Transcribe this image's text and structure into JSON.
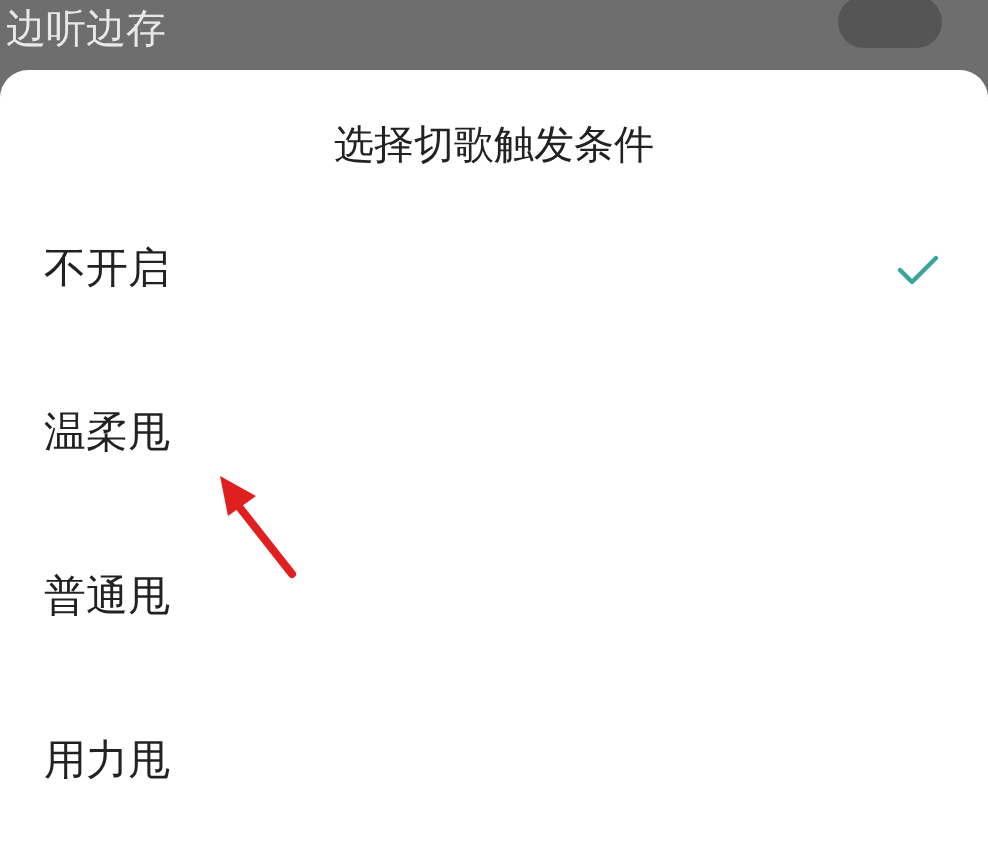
{
  "background_setting": {
    "label": "边听边存",
    "on": false
  },
  "sheet": {
    "title": "选择切歌触发条件",
    "options": [
      {
        "label": "不开启",
        "selected": true
      },
      {
        "label": "温柔甩",
        "selected": false
      },
      {
        "label": "普通甩",
        "selected": false
      },
      {
        "label": "用力甩",
        "selected": false
      }
    ]
  }
}
